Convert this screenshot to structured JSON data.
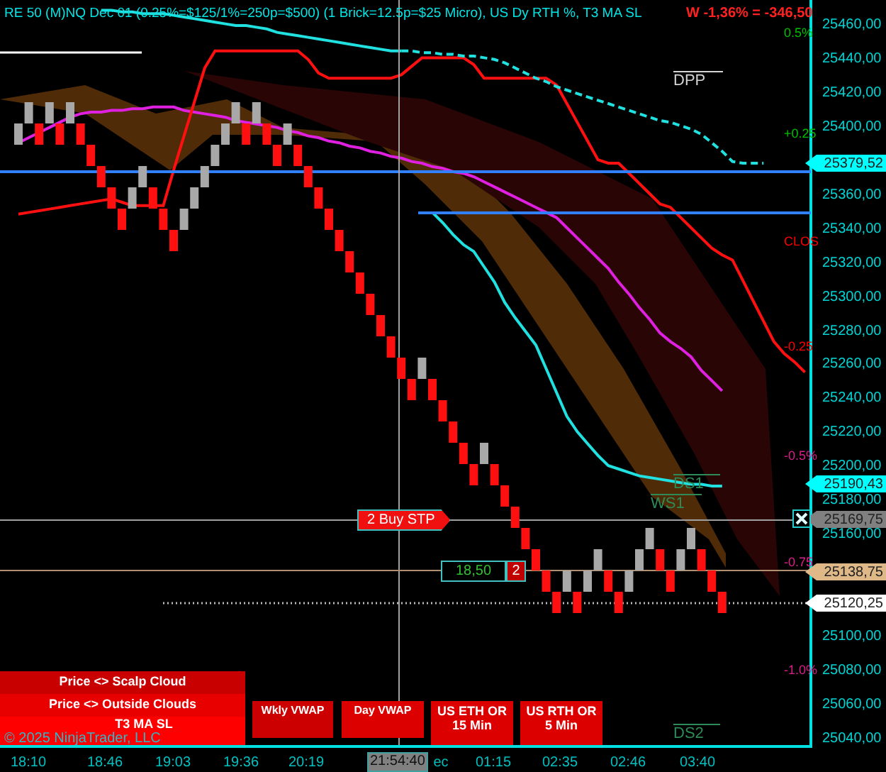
{
  "header": {
    "title": "RE 50 (M)NQ Dec 01 (0.25%=$125/1%=250p=$500)  (1 Brick=12.5p=$25 Micro), US Dy RTH %, T3 MA SL",
    "pnl": "W -1,36% = -346,50"
  },
  "chart_data": {
    "type": "line",
    "ylim": [
      25036.6,
      25475
    ],
    "yticks": [
      {
        "value": 25460,
        "label": "25460,00"
      },
      {
        "value": 25440,
        "label": "25440,00"
      },
      {
        "value": 25420,
        "label": "25420,00"
      },
      {
        "value": 25400,
        "label": "25400,00"
      },
      {
        "value": 25360,
        "label": "25360,00"
      },
      {
        "value": 25340,
        "label": "25340,00"
      },
      {
        "value": 25320,
        "label": "25320,00"
      },
      {
        "value": 25300,
        "label": "25300,00"
      },
      {
        "value": 25280,
        "label": "25280,00"
      },
      {
        "value": 25260,
        "label": "25260,00"
      },
      {
        "value": 25240,
        "label": "25240,00"
      },
      {
        "value": 25220,
        "label": "25220,00"
      },
      {
        "value": 25200,
        "label": "25200,00"
      },
      {
        "value": 25180,
        "label": "25180,00"
      },
      {
        "value": 25160,
        "label": "25160,00"
      },
      {
        "value": 25100,
        "label": "25100,00"
      },
      {
        "value": 25080,
        "label": "25080,00"
      },
      {
        "value": 25060,
        "label": "25060,00"
      },
      {
        "value": 25040,
        "label": "25040,00"
      }
    ],
    "series": [
      {
        "color": "#e020e0",
        "values": [
          25391,
          25394,
          25397,
          25400,
          25403,
          25406,
          25408,
          25409,
          25409,
          25410,
          25410,
          25411,
          25411,
          25412,
          25412,
          25412,
          25410,
          25409,
          25408,
          25407,
          25406,
          25404,
          25403,
          25402,
          25401,
          25400,
          25398,
          25397,
          25395,
          25394,
          25392,
          25391,
          25389,
          25388,
          25386,
          25385,
          25383,
          25382,
          25380,
          25379,
          25377,
          25376,
          25374,
          25373,
          25371,
          25368,
          25365,
          25362,
          25359,
          25356,
          25353,
          25350,
          25347,
          25341,
          25335,
          25329,
          25323,
          25317,
          25309,
          25302,
          25294,
          25287,
          25279,
          25274,
          25270,
          25265,
          25257,
          25251,
          25245
        ]
      },
      {
        "color": "#ff1010",
        "values": [
          25349,
          25350,
          25351,
          25352,
          25353,
          25354,
          25355,
          25356,
          25357,
          25358,
          25356,
          25354,
          25354,
          25354,
          25354,
          25375,
          25395,
          25415,
          25435,
          25445,
          25445,
          25445,
          25445,
          25445,
          25445,
          25445,
          25445,
          25445,
          25440,
          25432,
          25429,
          25429,
          25429,
          25429,
          25429,
          25429,
          25429,
          25431,
          25436,
          25441,
          25441,
          25441,
          25441,
          25441,
          25437,
          25429,
          25429,
          25429,
          25429,
          25429,
          25429,
          25429,
          25425,
          25414,
          25403,
          25392,
          25381,
          25379,
          25379,
          25373,
          25367,
          25361,
          25355,
          25353,
          25347,
          25341,
          25335,
          25329,
          25325,
          25322,
          25310,
          25298,
          25286,
          25274,
          25267,
          25262,
          25256
        ]
      },
      {
        "color": "#20e0e0",
        "values": [
          null,
          null,
          null,
          null,
          null,
          null,
          null,
          null,
          25469,
          25469,
          25468,
          25468,
          25467,
          25467,
          25467,
          25466,
          25465,
          25464,
          25463,
          25462,
          25461,
          25460,
          25460,
          25459,
          25458,
          25456,
          25455,
          25454,
          25453,
          25452,
          25451,
          25450,
          25449,
          25448,
          25447,
          25446,
          25445,
          25445
        ]
      },
      {
        "color": "#20e0e0",
        "line_style": "dashed",
        "values": [
          null,
          null,
          null,
          null,
          null,
          null,
          null,
          null,
          null,
          null,
          null,
          null,
          null,
          null,
          null,
          null,
          null,
          null,
          null,
          null,
          null,
          null,
          null,
          null,
          null,
          null,
          null,
          null,
          null,
          null,
          null,
          null,
          null,
          null,
          null,
          null,
          null,
          25445,
          25445,
          25444,
          25444,
          25443,
          25443,
          25442,
          25442,
          25441,
          25440,
          25438,
          25435,
          25432,
          25429,
          25427,
          25424,
          25422,
          25420,
          25418,
          25416,
          25414,
          25412,
          25410,
          25408,
          25406,
          25404,
          25403,
          25401,
          25399,
          25396,
          25391,
          25386,
          25380,
          25379,
          25379,
          25379
        ]
      },
      {
        "color": "#20e0e0",
        "values": [
          null,
          null,
          null,
          null,
          null,
          null,
          null,
          null,
          null,
          null,
          null,
          null,
          null,
          null,
          null,
          null,
          null,
          null,
          null,
          null,
          null,
          null,
          null,
          null,
          null,
          null,
          null,
          null,
          null,
          null,
          null,
          null,
          null,
          null,
          null,
          null,
          null,
          null,
          null,
          null,
          25350,
          25344,
          25337,
          25331,
          25327,
          25318,
          25309,
          25297,
          25288,
          25280,
          25272,
          25258,
          25244,
          25230,
          25221,
          25214,
          25207,
          25201,
          25199,
          25197,
          25195,
          25194,
          25193,
          25192,
          25191,
          25190,
          25190,
          25189,
          25189
        ]
      }
    ]
  },
  "time_labels": [
    "18:10",
    "18:46",
    "19:03",
    "19:36",
    "20:19",
    "ec",
    "01:15",
    "02:35",
    "02:46",
    "03:40"
  ],
  "price_markers": [
    {
      "text": "25379,52",
      "color": "#00ffff"
    },
    {
      "text": "25190,43",
      "color": "#00ffff"
    },
    {
      "text": "25169,75",
      "color": "#808080"
    },
    {
      "text": "25138,75",
      "color": "#deb887"
    },
    {
      "text": "25120,25",
      "color": "#ffffff"
    }
  ],
  "level_labels": [
    {
      "text": "0.5%",
      "color": "#00c000"
    },
    {
      "text": "+0.25",
      "color": "#00c000"
    },
    {
      "text": "CLOS",
      "color": "#ff0000"
    },
    {
      "text": "-0.25",
      "color": "#ff0000"
    },
    {
      "text": "-0.5%",
      "color": "#dc1e8c"
    },
    {
      "text": "-0.75",
      "color": "#dc1e8c"
    },
    {
      "text": "-1.0%",
      "color": "#dc1e8c"
    }
  ],
  "pivots": [
    {
      "text": "DPP",
      "color": "#d3d3d3"
    },
    {
      "text": "DS1",
      "color": "#2e8b57"
    },
    {
      "text": "WS1",
      "color": "#2e8b57"
    },
    {
      "text": "DS2",
      "color": "#2e8b57"
    }
  ],
  "order": {
    "label": "2 Buy STP"
  },
  "position": {
    "value": "18,50",
    "quantity": "2"
  },
  "buttons": [
    "Price <> Scalp Cloud",
    "Price <> Outside Clouds",
    "T3 MA SL",
    "Wkly VWAP",
    "Day VWAP",
    "US ETH OR 15 Min",
    "US RTH OR 5 Min"
  ],
  "copyright": "© 2025 NinjaTrader, LLC",
  "cursor_time": "21:54:40"
}
